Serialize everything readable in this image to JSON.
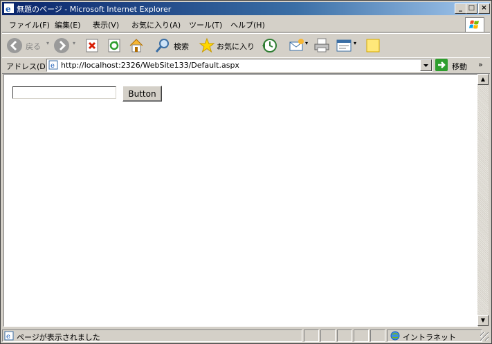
{
  "window": {
    "title": "無題のページ - Microsoft Internet Explorer"
  },
  "menubar": {
    "items": [
      "ファイル(F)",
      "編集(E)",
      "表示(V)",
      "お気に入り(A)",
      "ツール(T)",
      "ヘルプ(H)"
    ]
  },
  "toolbar": {
    "back_label": "戻る",
    "search_label": "検索",
    "favorites_label": "お気に入り"
  },
  "address": {
    "label": "アドレス(D)",
    "url": "http://localhost:2326/WebSite133/Default.aspx",
    "go_label": "移動",
    "links_chevron": "»"
  },
  "page": {
    "text_input_value": "",
    "button_label": "Button"
  },
  "status": {
    "text": "ページが表示されました",
    "zone": "イントラネット"
  }
}
